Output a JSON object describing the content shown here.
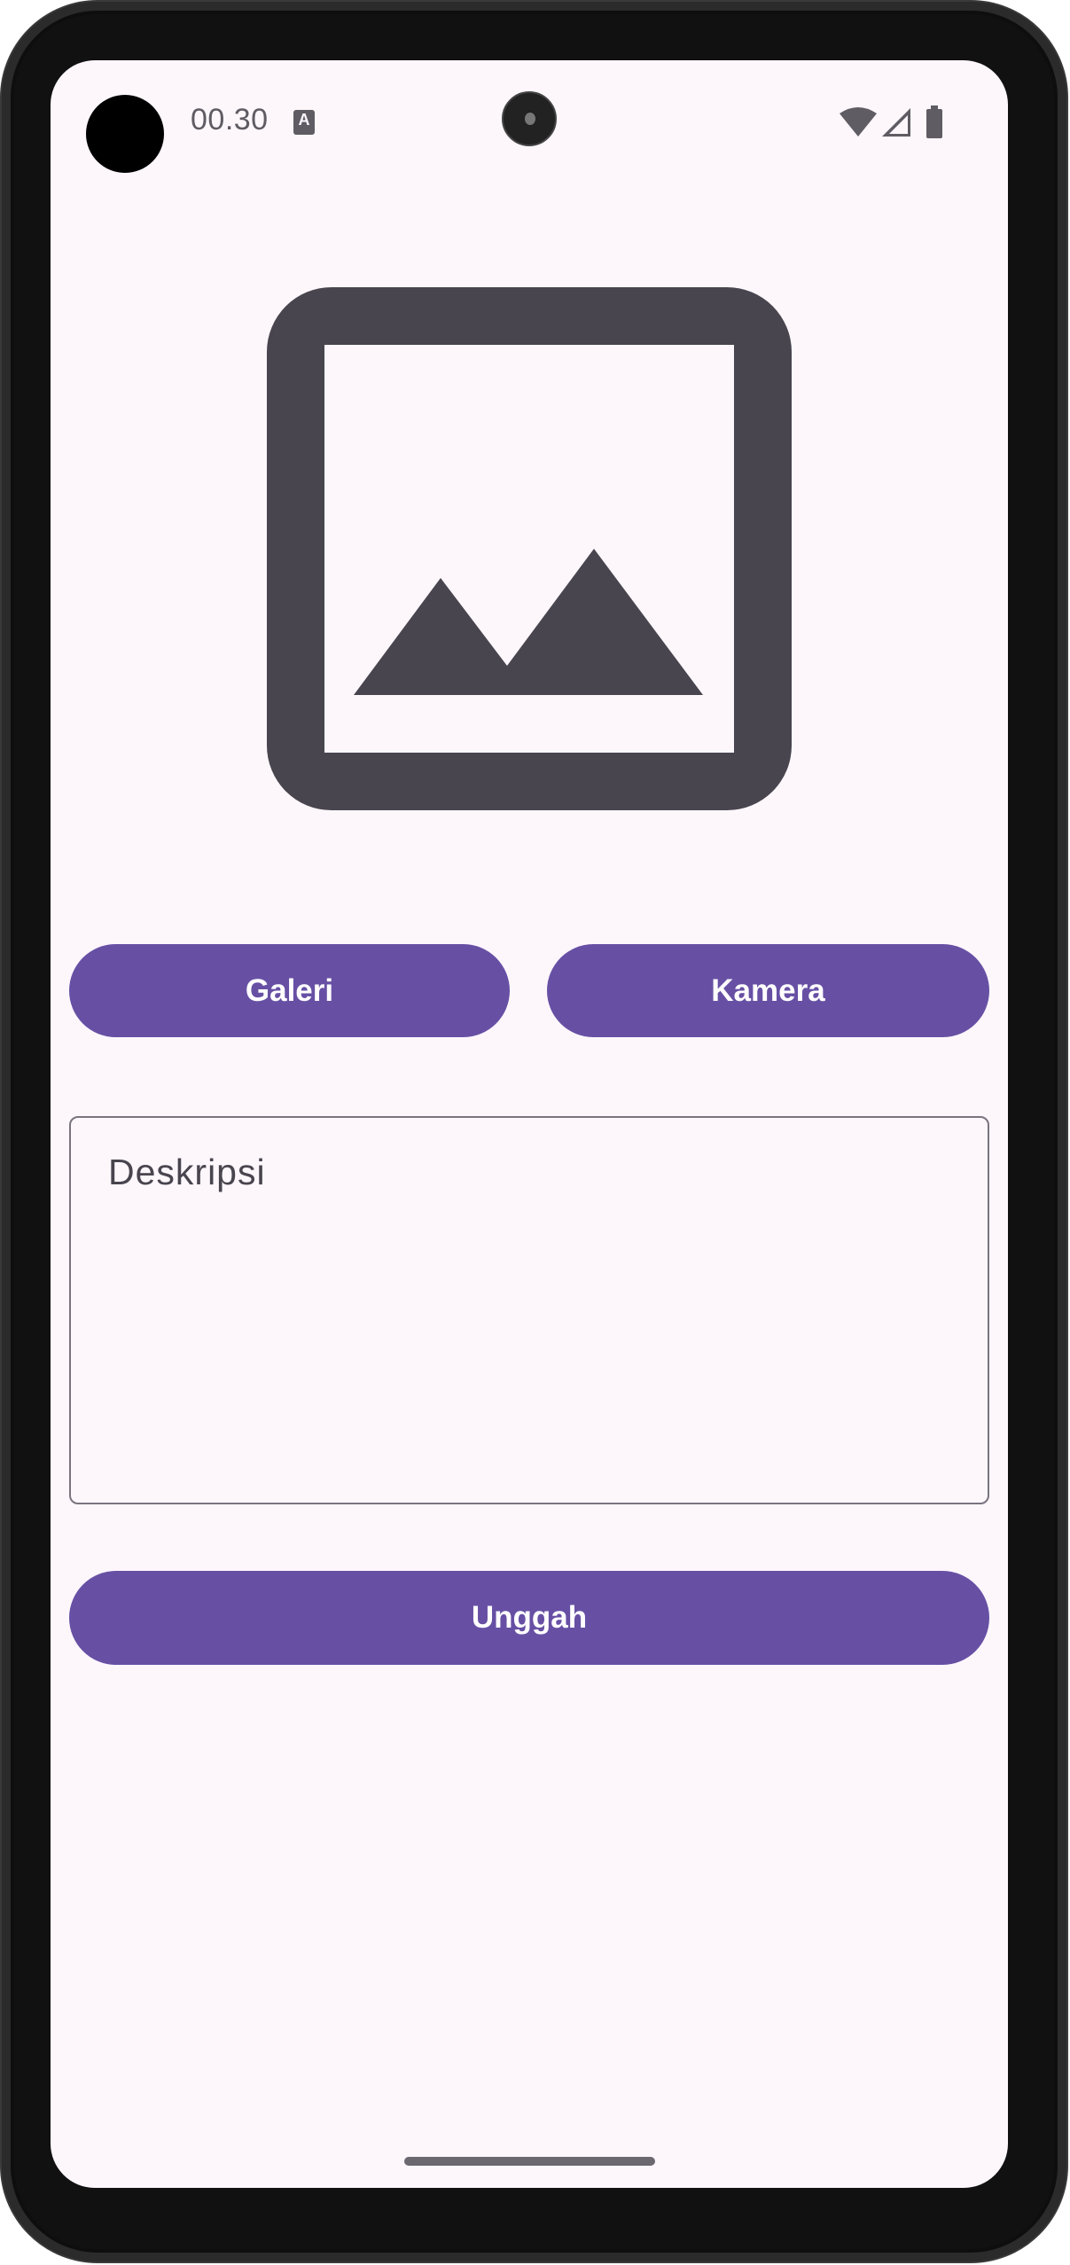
{
  "status_bar": {
    "time": "00.30",
    "notification_icon": "a-keyboard-icon",
    "icons": [
      "wifi-icon",
      "signal-icon",
      "battery-icon"
    ]
  },
  "image_preview": {
    "icon": "image-placeholder-icon"
  },
  "buttons": {
    "gallery": "Galeri",
    "camera": "Kamera",
    "upload": "Unggah"
  },
  "description_field": {
    "placeholder": "Deskripsi",
    "value": ""
  },
  "colors": {
    "primary": "#6750a4",
    "background": "#fdf7fc",
    "icon": "#48454e",
    "outline": "#79747e"
  }
}
